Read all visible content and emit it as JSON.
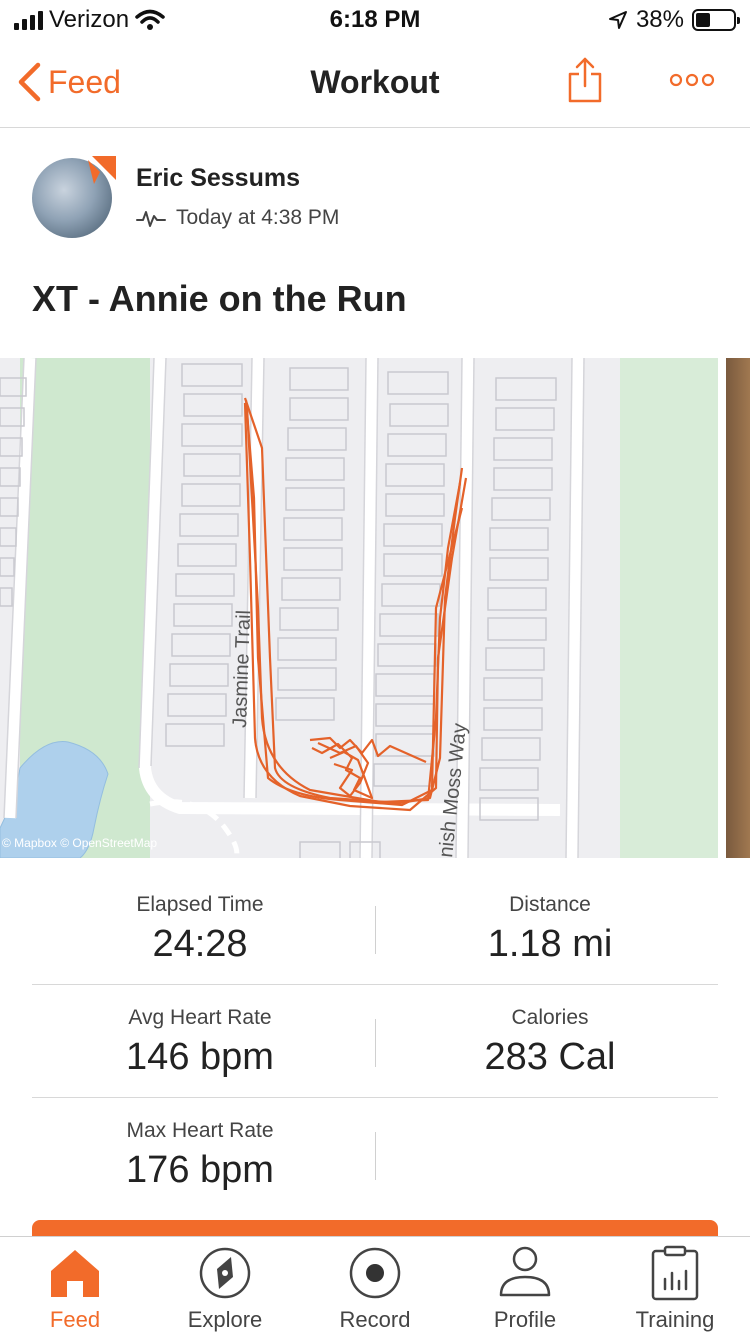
{
  "status_bar": {
    "carrier": "Verizon",
    "time": "6:18 PM",
    "battery_percent": "38%",
    "battery_level": 0.38,
    "icons": [
      "signal-icon",
      "wifi-icon",
      "location-arrow-icon",
      "battery-icon"
    ]
  },
  "nav": {
    "back_label": "Feed",
    "title": "Workout",
    "icons": [
      "chevron-left-icon",
      "share-icon",
      "more-icon"
    ]
  },
  "header": {
    "athlete_name": "Eric Sessums",
    "timestamp": "Today at 4:38 PM",
    "activity_icon": "heartbeat-icon"
  },
  "workout": {
    "title": "XT - Annie on the Run"
  },
  "map": {
    "street_labels": [
      "Jasmine Trail",
      "nish Moss Way"
    ],
    "attribution": "© Mapbox © OpenStreetMap",
    "route_color": "#e4622a",
    "park_color": "#cfe8cf",
    "water_color": "#aed0ec"
  },
  "stats": [
    {
      "label": "Elapsed Time",
      "value": "24:28"
    },
    {
      "label": "Distance",
      "value": "1.18 mi"
    },
    {
      "label": "Avg Heart Rate",
      "value": "146 bpm"
    },
    {
      "label": "Calories",
      "value": "283 Cal"
    },
    {
      "label": "Max Heart Rate",
      "value": "176 bpm"
    }
  ],
  "tabs": [
    {
      "label": "Feed",
      "icon": "home-icon",
      "active": true
    },
    {
      "label": "Explore",
      "icon": "compass-icon",
      "active": false
    },
    {
      "label": "Record",
      "icon": "record-icon",
      "active": false
    },
    {
      "label": "Profile",
      "icon": "profile-icon",
      "active": false
    },
    {
      "label": "Training",
      "icon": "training-calendar-icon",
      "active": false
    }
  ],
  "colors": {
    "accent": "#f26b2a",
    "text": "#222222",
    "muted": "#444444",
    "divider": "#d8d8d8"
  }
}
